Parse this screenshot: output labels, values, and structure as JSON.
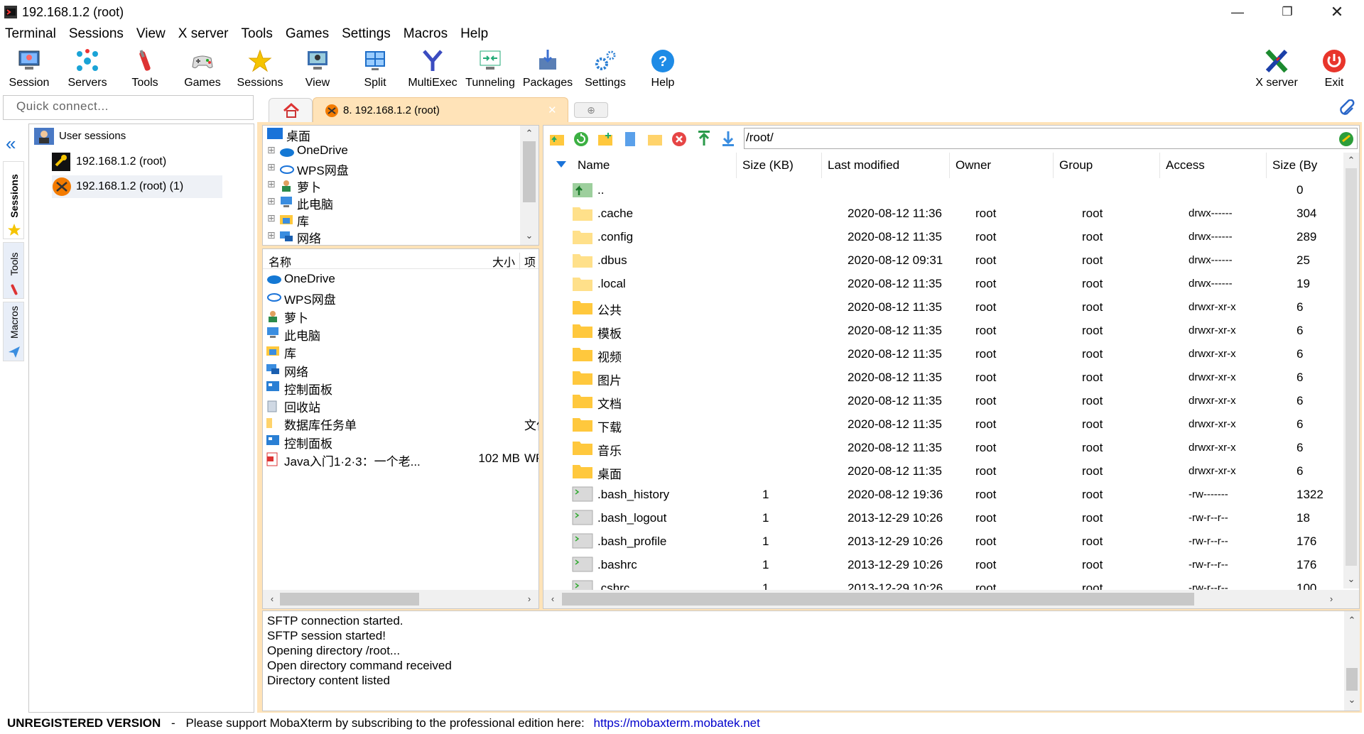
{
  "window": {
    "title": "192.168.1.2 (root)"
  },
  "menu": [
    "Terminal",
    "Sessions",
    "View",
    "X server",
    "Tools",
    "Games",
    "Settings",
    "Macros",
    "Help"
  ],
  "toolbar": {
    "session": "Session",
    "servers": "Servers",
    "tools": "Tools",
    "games": "Games",
    "sessions": "Sessions",
    "view": "View",
    "split": "Split",
    "multiexec": "MultiExec",
    "tunneling": "Tunneling",
    "packages": "Packages",
    "settings": "Settings",
    "help": "Help",
    "xserver": "X server",
    "exit": "Exit"
  },
  "quick_connect": {
    "placeholder": "Quick connect..."
  },
  "tab": {
    "label": "8. 192.168.1.2 (root)"
  },
  "sidetabs": [
    "Sessions",
    "Tools",
    "Macros"
  ],
  "sessions": {
    "root": "User sessions",
    "items": [
      "192.168.1.2 (root)",
      "192.168.1.2 (root) (1)"
    ]
  },
  "local_tree": [
    "桌面",
    "OneDrive",
    "WPS网盘",
    "萝卜",
    "此电脑",
    "库",
    "网络"
  ],
  "local_list": {
    "headers": {
      "name": "名称",
      "size": "大小",
      "type": "项"
    },
    "items": [
      {
        "name": "OneDrive",
        "size": "",
        "type": ""
      },
      {
        "name": "WPS网盘",
        "size": "",
        "type": ""
      },
      {
        "name": "萝卜",
        "size": "",
        "type": ""
      },
      {
        "name": "此电脑",
        "size": "",
        "type": ""
      },
      {
        "name": "库",
        "size": "",
        "type": ""
      },
      {
        "name": "网络",
        "size": "",
        "type": ""
      },
      {
        "name": "控制面板",
        "size": "",
        "type": ""
      },
      {
        "name": "回收站",
        "size": "",
        "type": ""
      },
      {
        "name": "数据库任务单",
        "size": "",
        "type": "文件"
      },
      {
        "name": "控制面板",
        "size": "",
        "type": ""
      },
      {
        "name": "Java入门1·2·3：一个老...",
        "size": "102 MB",
        "type": "WPS"
      }
    ]
  },
  "remote": {
    "path": "/root/",
    "headers": {
      "name": "Name",
      "size": "Size (KB)",
      "modified": "Last modified",
      "owner": "Owner",
      "group": "Group",
      "access": "Access",
      "bytes": "Size (By"
    },
    "rows": [
      {
        "name": "..",
        "kind": "up",
        "size": "",
        "modified": "",
        "owner": "",
        "group": "",
        "access": "",
        "bytes": "0"
      },
      {
        "name": ".cache",
        "kind": "folder-light",
        "size": "",
        "modified": "2020-08-12 11:36",
        "owner": "root",
        "group": "root",
        "access": "drwx------",
        "bytes": "304"
      },
      {
        "name": ".config",
        "kind": "folder-light",
        "size": "",
        "modified": "2020-08-12 11:35",
        "owner": "root",
        "group": "root",
        "access": "drwx------",
        "bytes": "289"
      },
      {
        "name": ".dbus",
        "kind": "folder-light",
        "size": "",
        "modified": "2020-08-12 09:31",
        "owner": "root",
        "group": "root",
        "access": "drwx------",
        "bytes": "25"
      },
      {
        "name": ".local",
        "kind": "folder-light",
        "size": "",
        "modified": "2020-08-12 11:35",
        "owner": "root",
        "group": "root",
        "access": "drwx------",
        "bytes": "19"
      },
      {
        "name": "公共",
        "kind": "folder",
        "size": "",
        "modified": "2020-08-12 11:35",
        "owner": "root",
        "group": "root",
        "access": "drwxr-xr-x",
        "bytes": "6"
      },
      {
        "name": "模板",
        "kind": "folder",
        "size": "",
        "modified": "2020-08-12 11:35",
        "owner": "root",
        "group": "root",
        "access": "drwxr-xr-x",
        "bytes": "6"
      },
      {
        "name": "视频",
        "kind": "folder",
        "size": "",
        "modified": "2020-08-12 11:35",
        "owner": "root",
        "group": "root",
        "access": "drwxr-xr-x",
        "bytes": "6"
      },
      {
        "name": "图片",
        "kind": "folder",
        "size": "",
        "modified": "2020-08-12 11:35",
        "owner": "root",
        "group": "root",
        "access": "drwxr-xr-x",
        "bytes": "6"
      },
      {
        "name": "文档",
        "kind": "folder",
        "size": "",
        "modified": "2020-08-12 11:35",
        "owner": "root",
        "group": "root",
        "access": "drwxr-xr-x",
        "bytes": "6"
      },
      {
        "name": "下载",
        "kind": "folder",
        "size": "",
        "modified": "2020-08-12 11:35",
        "owner": "root",
        "group": "root",
        "access": "drwxr-xr-x",
        "bytes": "6"
      },
      {
        "name": "音乐",
        "kind": "folder",
        "size": "",
        "modified": "2020-08-12 11:35",
        "owner": "root",
        "group": "root",
        "access": "drwxr-xr-x",
        "bytes": "6"
      },
      {
        "name": "桌面",
        "kind": "folder",
        "size": "",
        "modified": "2020-08-12 11:35",
        "owner": "root",
        "group": "root",
        "access": "drwxr-xr-x",
        "bytes": "6"
      },
      {
        "name": ".bash_history",
        "kind": "file",
        "size": "1",
        "modified": "2020-08-12 19:36",
        "owner": "root",
        "group": "root",
        "access": "-rw-------",
        "bytes": "1322"
      },
      {
        "name": ".bash_logout",
        "kind": "file",
        "size": "1",
        "modified": "2013-12-29 10:26",
        "owner": "root",
        "group": "root",
        "access": "-rw-r--r--",
        "bytes": "18"
      },
      {
        "name": ".bash_profile",
        "kind": "file",
        "size": "1",
        "modified": "2013-12-29 10:26",
        "owner": "root",
        "group": "root",
        "access": "-rw-r--r--",
        "bytes": "176"
      },
      {
        "name": ".bashrc",
        "kind": "file",
        "size": "1",
        "modified": "2013-12-29 10:26",
        "owner": "root",
        "group": "root",
        "access": "-rw-r--r--",
        "bytes": "176"
      },
      {
        "name": ".cshrc",
        "kind": "file",
        "size": "1",
        "modified": "2013-12-29 10:26",
        "owner": "root",
        "group": "root",
        "access": "-rw-r--r--",
        "bytes": "100"
      }
    ]
  },
  "log": [
    "SFTP connection started.",
    "SFTP session started!",
    "Opening directory /root...",
    "Open directory command received",
    "Directory content listed"
  ],
  "status": {
    "unregistered": "UNREGISTERED VERSION",
    "sep": "-",
    "message": "Please support MobaXterm by subscribing to the professional edition here:",
    "link": "https://mobaxterm.mobatek.net"
  },
  "colors": {
    "accent_tab": "#ffe3b8",
    "link": "#0000cc",
    "folder": "#ffc83d"
  }
}
